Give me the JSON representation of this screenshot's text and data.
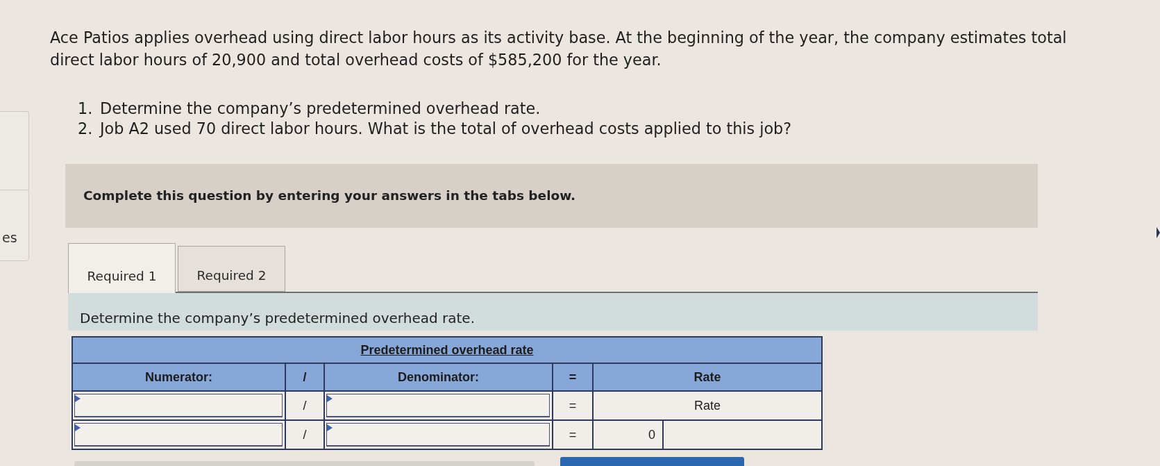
{
  "side_panel": {
    "label": "es"
  },
  "question": {
    "text": "Ace Patios applies overhead using direct labor hours as its activity base. At the beginning of the year, the company estimates total direct labor hours of 20,900 and total overhead costs of $585,200 for the year.",
    "steps": [
      {
        "number": "1.",
        "text": "Determine the company’s predetermined overhead rate."
      },
      {
        "number": "2.",
        "text": "Job A2 used 70 direct labor hours. What is the total of overhead costs applied to this job?"
      }
    ]
  },
  "banner": {
    "text": "Complete this question by entering your answers in the tabs below."
  },
  "tabs": [
    {
      "label": "Required 1",
      "selected": true
    },
    {
      "label": "Required 2",
      "selected": false
    }
  ],
  "panel": {
    "instruction": "Determine the company’s predetermined overhead rate."
  },
  "table": {
    "title": "Predetermined overhead rate",
    "columns": [
      "Numerator:",
      "/",
      "Denominator:",
      "=",
      "Rate"
    ],
    "rows": [
      {
        "kind": "label",
        "operator": "/",
        "equals": "=",
        "result": "Rate"
      },
      {
        "kind": "split",
        "operator": "/",
        "equals": "=",
        "result": "0"
      }
    ]
  }
}
